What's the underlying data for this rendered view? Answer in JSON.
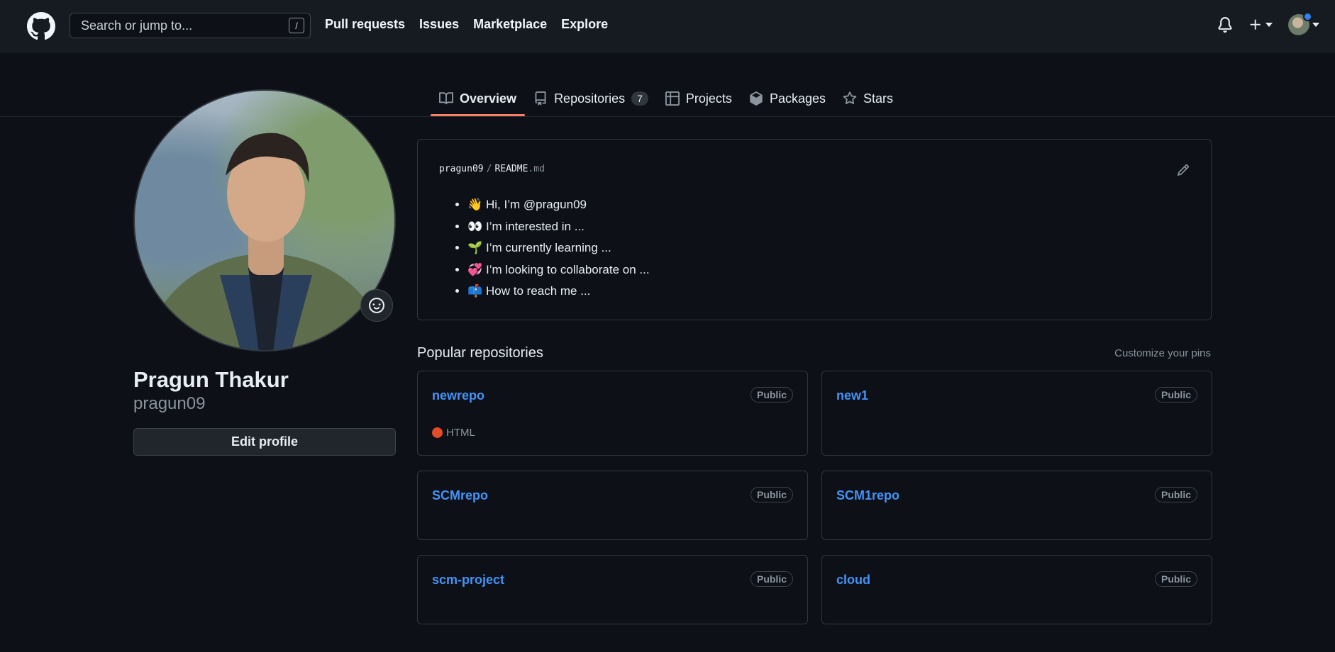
{
  "header": {
    "search_placeholder": "Search or jump to...",
    "search_shortcut": "/",
    "nav": [
      "Pull requests",
      "Issues",
      "Marketplace",
      "Explore"
    ]
  },
  "tabs": [
    {
      "label": "Overview",
      "icon": "book-icon",
      "active": true
    },
    {
      "label": "Repositories",
      "icon": "repo-icon",
      "count": "7"
    },
    {
      "label": "Projects",
      "icon": "table-icon"
    },
    {
      "label": "Packages",
      "icon": "package-icon"
    },
    {
      "label": "Stars",
      "icon": "star-icon"
    }
  ],
  "profile": {
    "full_name": "Pragun Thakur",
    "username": "pragun09",
    "edit_label": "Edit profile"
  },
  "readme": {
    "owner": "pragun09",
    "separator": "/",
    "file": "README",
    "ext": ".md",
    "items": [
      {
        "emoji": "👋",
        "text": "Hi, I’m @pragun09"
      },
      {
        "emoji": "👀",
        "text": "I’m interested in ..."
      },
      {
        "emoji": "🌱",
        "text": "I’m currently learning ..."
      },
      {
        "emoji": "💞️",
        "text": "I’m looking to collaborate on ..."
      },
      {
        "emoji": "📫",
        "text": "How to reach me ..."
      }
    ]
  },
  "popular": {
    "title": "Popular repositories",
    "customize": "Customize your pins",
    "repos": [
      {
        "name": "newrepo",
        "visibility": "Public",
        "language": "HTML",
        "language_color": "#e34c26"
      },
      {
        "name": "new1",
        "visibility": "Public"
      },
      {
        "name": "SCMrepo",
        "visibility": "Public"
      },
      {
        "name": "SCM1repo",
        "visibility": "Public"
      },
      {
        "name": "scm-project",
        "visibility": "Public"
      },
      {
        "name": "cloud",
        "visibility": "Public"
      }
    ]
  },
  "colors": {
    "accent": "#f78166",
    "link": "#4493f8",
    "bg": "#0d1117",
    "header_bg": "#161b22"
  }
}
